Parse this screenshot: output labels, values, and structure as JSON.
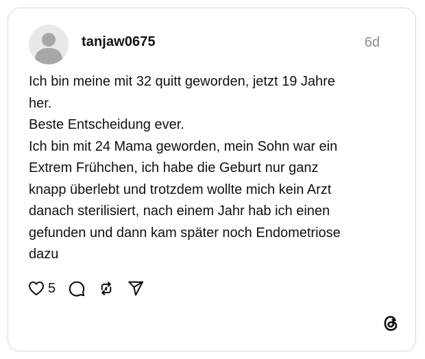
{
  "post": {
    "username": "tanjaw0675",
    "time_ago": "6d",
    "avatar_icon": "default-user-avatar",
    "text_lines": [
      "Ich bin meine mit 32 quitt geworden, jetzt 19 Jahre",
      "her.",
      "Beste Entscheidung ever.",
      "Ich bin mit 24 Mama geworden, mein Sohn war ein",
      "Extrem Frühchen, ich habe die Geburt nur ganz",
      "knapp überlebt und trotzdem wollte mich kein Arzt",
      "danach sterilisiert, nach einem Jahr hab ich einen",
      "gefunden und dann kam später noch Endometriose",
      "dazu"
    ]
  },
  "actions": {
    "like_icon": "heart-icon",
    "like_count": "5",
    "reply_icon": "comment-icon",
    "repost_icon": "repost-icon",
    "share_icon": "send-icon"
  },
  "brand": {
    "logo_icon": "threads-logo-icon"
  },
  "colors": {
    "text": "#111111",
    "muted": "#8a8a8a",
    "border": "#d9d9d9",
    "avatar_bg": "#e9e9e9",
    "avatar_fg": "#a7a7a7"
  }
}
